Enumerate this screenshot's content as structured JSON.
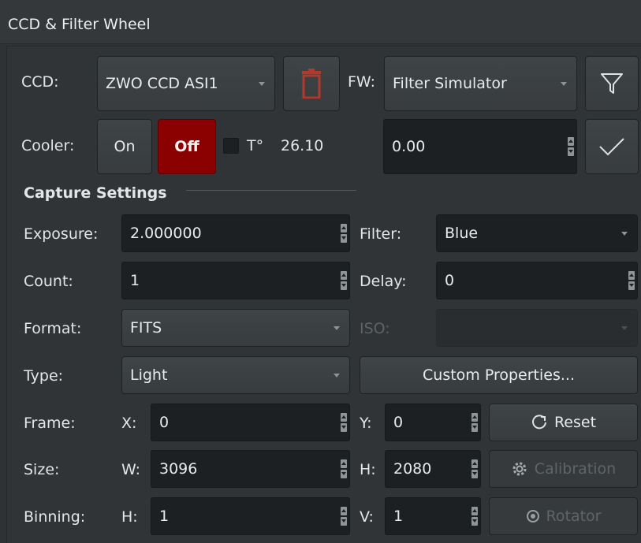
{
  "title": "CCD & Filter Wheel",
  "ccd": {
    "label": "CCD:",
    "value": "ZWO CCD ASI1"
  },
  "fw": {
    "label": "FW:",
    "value": "Filter Simulator"
  },
  "cooler": {
    "label": "Cooler:",
    "on_label": "On",
    "off_label": "Off",
    "temp_label": "T°",
    "temp_value": "26.10",
    "setpoint": "0.00"
  },
  "capture": {
    "heading": "Capture Settings",
    "exposure": {
      "label": "Exposure:",
      "value": "2.000000"
    },
    "filter": {
      "label": "Filter:",
      "value": "Blue"
    },
    "count": {
      "label": "Count:",
      "value": "1"
    },
    "delay": {
      "label": "Delay:",
      "value": "0"
    },
    "format": {
      "label": "Format:",
      "value": "FITS"
    },
    "iso": {
      "label": "ISO:",
      "value": ""
    },
    "type": {
      "label": "Type:",
      "value": "Light"
    },
    "custom_properties": "Custom Properties...",
    "frame": {
      "label": "Frame:",
      "x_label": "X:",
      "x_value": "0",
      "y_label": "Y:",
      "y_value": "0"
    },
    "reset": "Reset",
    "size": {
      "label": "Size:",
      "w_label": "W:",
      "w_value": "3096",
      "h_label": "H:",
      "h_value": "2080"
    },
    "calibration": "Calibration",
    "binning": {
      "label": "Binning:",
      "h_label": "H:",
      "h_value": "1",
      "v_label": "V:",
      "v_value": "1"
    },
    "rotator": "Rotator"
  },
  "colors": {
    "off_red": "#8b0000",
    "panel": "#303436",
    "field": "#1d2022"
  },
  "icons": [
    "delete-icon",
    "filter-funnel-icon",
    "checkmark-icon",
    "reset-icon",
    "gear-icon",
    "rotator-icon"
  ]
}
